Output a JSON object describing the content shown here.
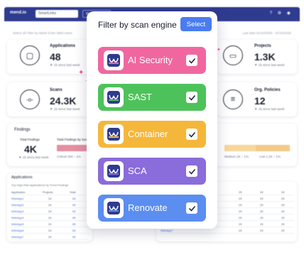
{
  "topbar": {
    "logo": "mend.io",
    "workspace": "SmartLinks",
    "button": "Workspace",
    "icons": "? ⚙ ◉"
  },
  "toolbar": {
    "left": "Select all      Filter by labels    Enter label name",
    "right": "Last date  01/10/2025 - 01/10/2025"
  },
  "stats": [
    {
      "label": "Applications",
      "value": "48",
      "delta": "▼ 15  since last week",
      "icon": "cube-icon",
      "glyph": "▢"
    },
    {
      "label": "Projects",
      "value": "1.3K",
      "delta": "▼ 15  since last week",
      "icon": "folder-icon",
      "glyph": "▭"
    },
    {
      "label": "Scans",
      "value": "24.3K",
      "delta": "▼ 15  since last week",
      "icon": "commit-icon",
      "glyph": "-o-"
    },
    {
      "label": "Org. Policies",
      "value": "12",
      "delta": "▼ 15  since last week",
      "icon": "policy-doc-icon",
      "glyph": "≡"
    }
  ],
  "findings": {
    "title": "Findings",
    "total_label": "Total Findings",
    "total_value": "4K",
    "total_delta": "▼ 15  since last week",
    "by_sev_label": "Total Findings by Severity",
    "critical": "Critical  250  ↑ 1%",
    "medium": "Medium  2K  ↑ 1%",
    "low": "Low  1.2K  ↑ 1%"
  },
  "applications": {
    "title": "Applications",
    "subtitle": "Top High-Risk Applications by Trend Findings",
    "headers": [
      "Application",
      "Projects",
      "Total"
    ],
    "rows": [
      [
        "WebApp1",
        "24",
        "65"
      ],
      [
        "WebApp2",
        "24",
        "65"
      ],
      [
        "WebApp3",
        "24",
        "65"
      ],
      [
        "WebApp4",
        "24",
        "65"
      ],
      [
        "WebApp5",
        "24",
        "65"
      ],
      [
        "WebApp6",
        "24",
        "65"
      ],
      [
        "WebApp7",
        "24",
        "65"
      ],
      [
        "WebApp8",
        "24",
        "65"
      ]
    ],
    "right_rows": [
      "29",
      "29",
      "29",
      "29",
      "29",
      "29",
      "29",
      "29"
    ]
  },
  "popup": {
    "title": "Filter by scan engine",
    "select_label": "Select",
    "engines": [
      {
        "label": "AI Security",
        "color": "#f0679f",
        "icon": "ai-security-logo-icon",
        "checked": true
      },
      {
        "label": "SAST",
        "color": "#4ec25a",
        "icon": "sast-logo-icon",
        "checked": true
      },
      {
        "label": "Container",
        "color": "#f5b73a",
        "icon": "container-logo-icon",
        "checked": true
      },
      {
        "label": "SCA",
        "color": "#8a6cdb",
        "icon": "sca-logo-icon",
        "checked": true
      },
      {
        "label": "Renovate",
        "color": "#5b8ef0",
        "icon": "renovate-logo-icon",
        "checked": true
      }
    ]
  },
  "colors": {
    "brand": "#2f3b8f",
    "accent": "#4a7cf0",
    "sparkle": "#ff4f9a"
  }
}
